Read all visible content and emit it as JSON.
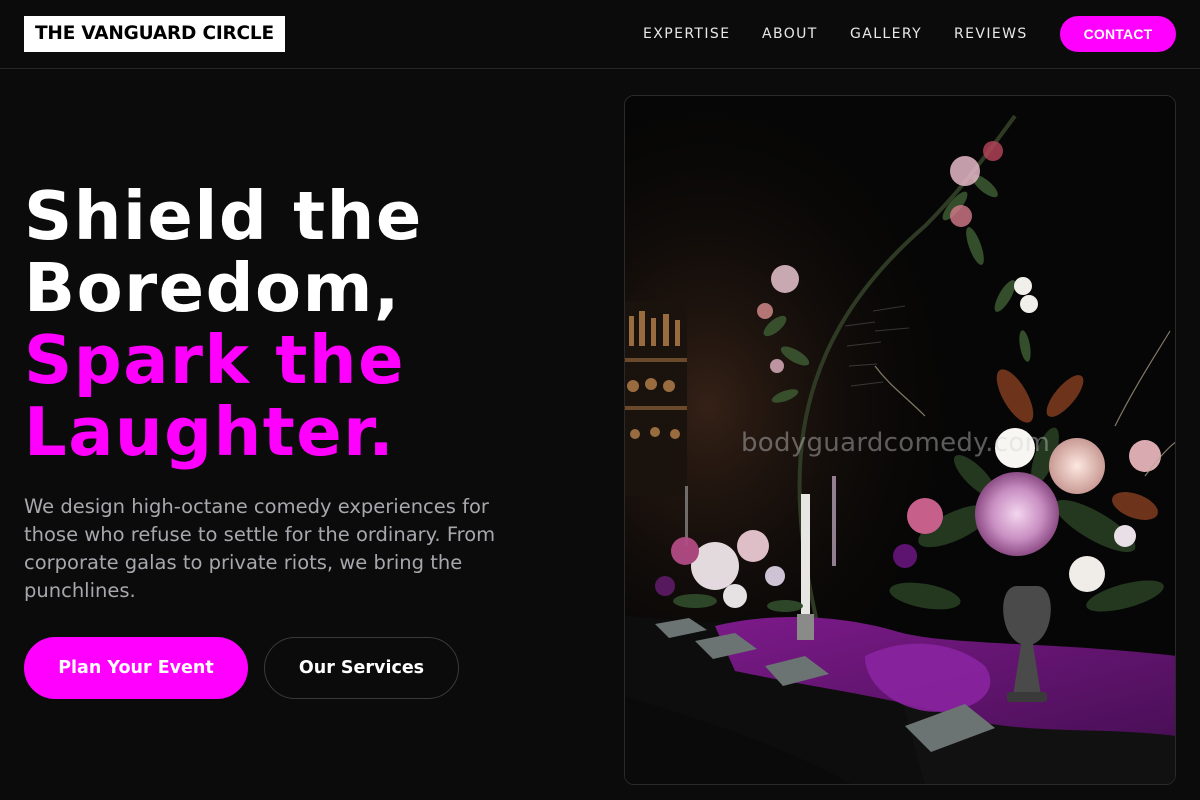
{
  "brand": {
    "name": "THE VANGUARD CIRCLE"
  },
  "nav": {
    "items": [
      {
        "label": "EXPERTISE"
      },
      {
        "label": "ABOUT"
      },
      {
        "label": "GALLERY"
      },
      {
        "label": "REVIEWS"
      }
    ],
    "contact_label": "CONTACT"
  },
  "hero": {
    "title_lines": [
      "Shield the",
      "Boredom,",
      "Spark the",
      "Laughter."
    ],
    "description": "We design high-octane comedy experiences for those who refuse to settle for the ordinary. From corporate galas to private riots, we bring the punchlines.",
    "primary_cta": "Plan Your Event",
    "secondary_cta": "Our Services"
  },
  "image": {
    "watermark": "bodyguardcomedy.com"
  },
  "colors": {
    "background": "#0b0b0b",
    "accent": "#ff00ff",
    "text_muted": "#a7a7ad"
  }
}
